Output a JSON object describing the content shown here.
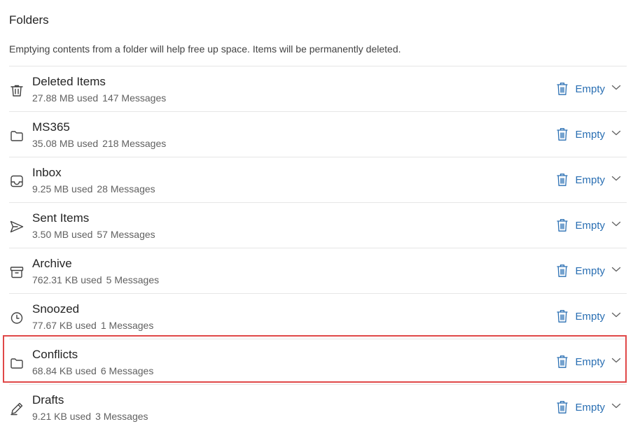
{
  "header": {
    "title": "Folders",
    "description": "Emptying contents from a folder will help free up space. Items will be permanently deleted."
  },
  "accent_color": "#2a6fb3",
  "highlight_color": "#e04848",
  "folders": [
    {
      "name": "Deleted Items",
      "size": "27.88 MB used",
      "count": "147 Messages",
      "icon": "trash-icon",
      "action": "Empty"
    },
    {
      "name": "MS365",
      "size": "35.08 MB used",
      "count": "218 Messages",
      "icon": "folder-icon",
      "action": "Empty"
    },
    {
      "name": "Inbox",
      "size": "9.25 MB used",
      "count": "28 Messages",
      "icon": "inbox-icon",
      "action": "Empty"
    },
    {
      "name": "Sent Items",
      "size": "3.50 MB used",
      "count": "57 Messages",
      "icon": "send-icon",
      "action": "Empty"
    },
    {
      "name": "Archive",
      "size": "762.31 KB used",
      "count": "5 Messages",
      "icon": "archive-icon",
      "action": "Empty"
    },
    {
      "name": "Snoozed",
      "size": "77.67 KB used",
      "count": "1 Messages",
      "icon": "clock-icon",
      "action": "Empty"
    },
    {
      "name": "Conflicts",
      "size": "68.84 KB used",
      "count": "6 Messages",
      "icon": "folder-icon",
      "action": "Empty",
      "highlighted": true
    },
    {
      "name": "Drafts",
      "size": "9.21 KB used",
      "count": "3 Messages",
      "icon": "pencil-icon",
      "action": "Empty"
    }
  ]
}
